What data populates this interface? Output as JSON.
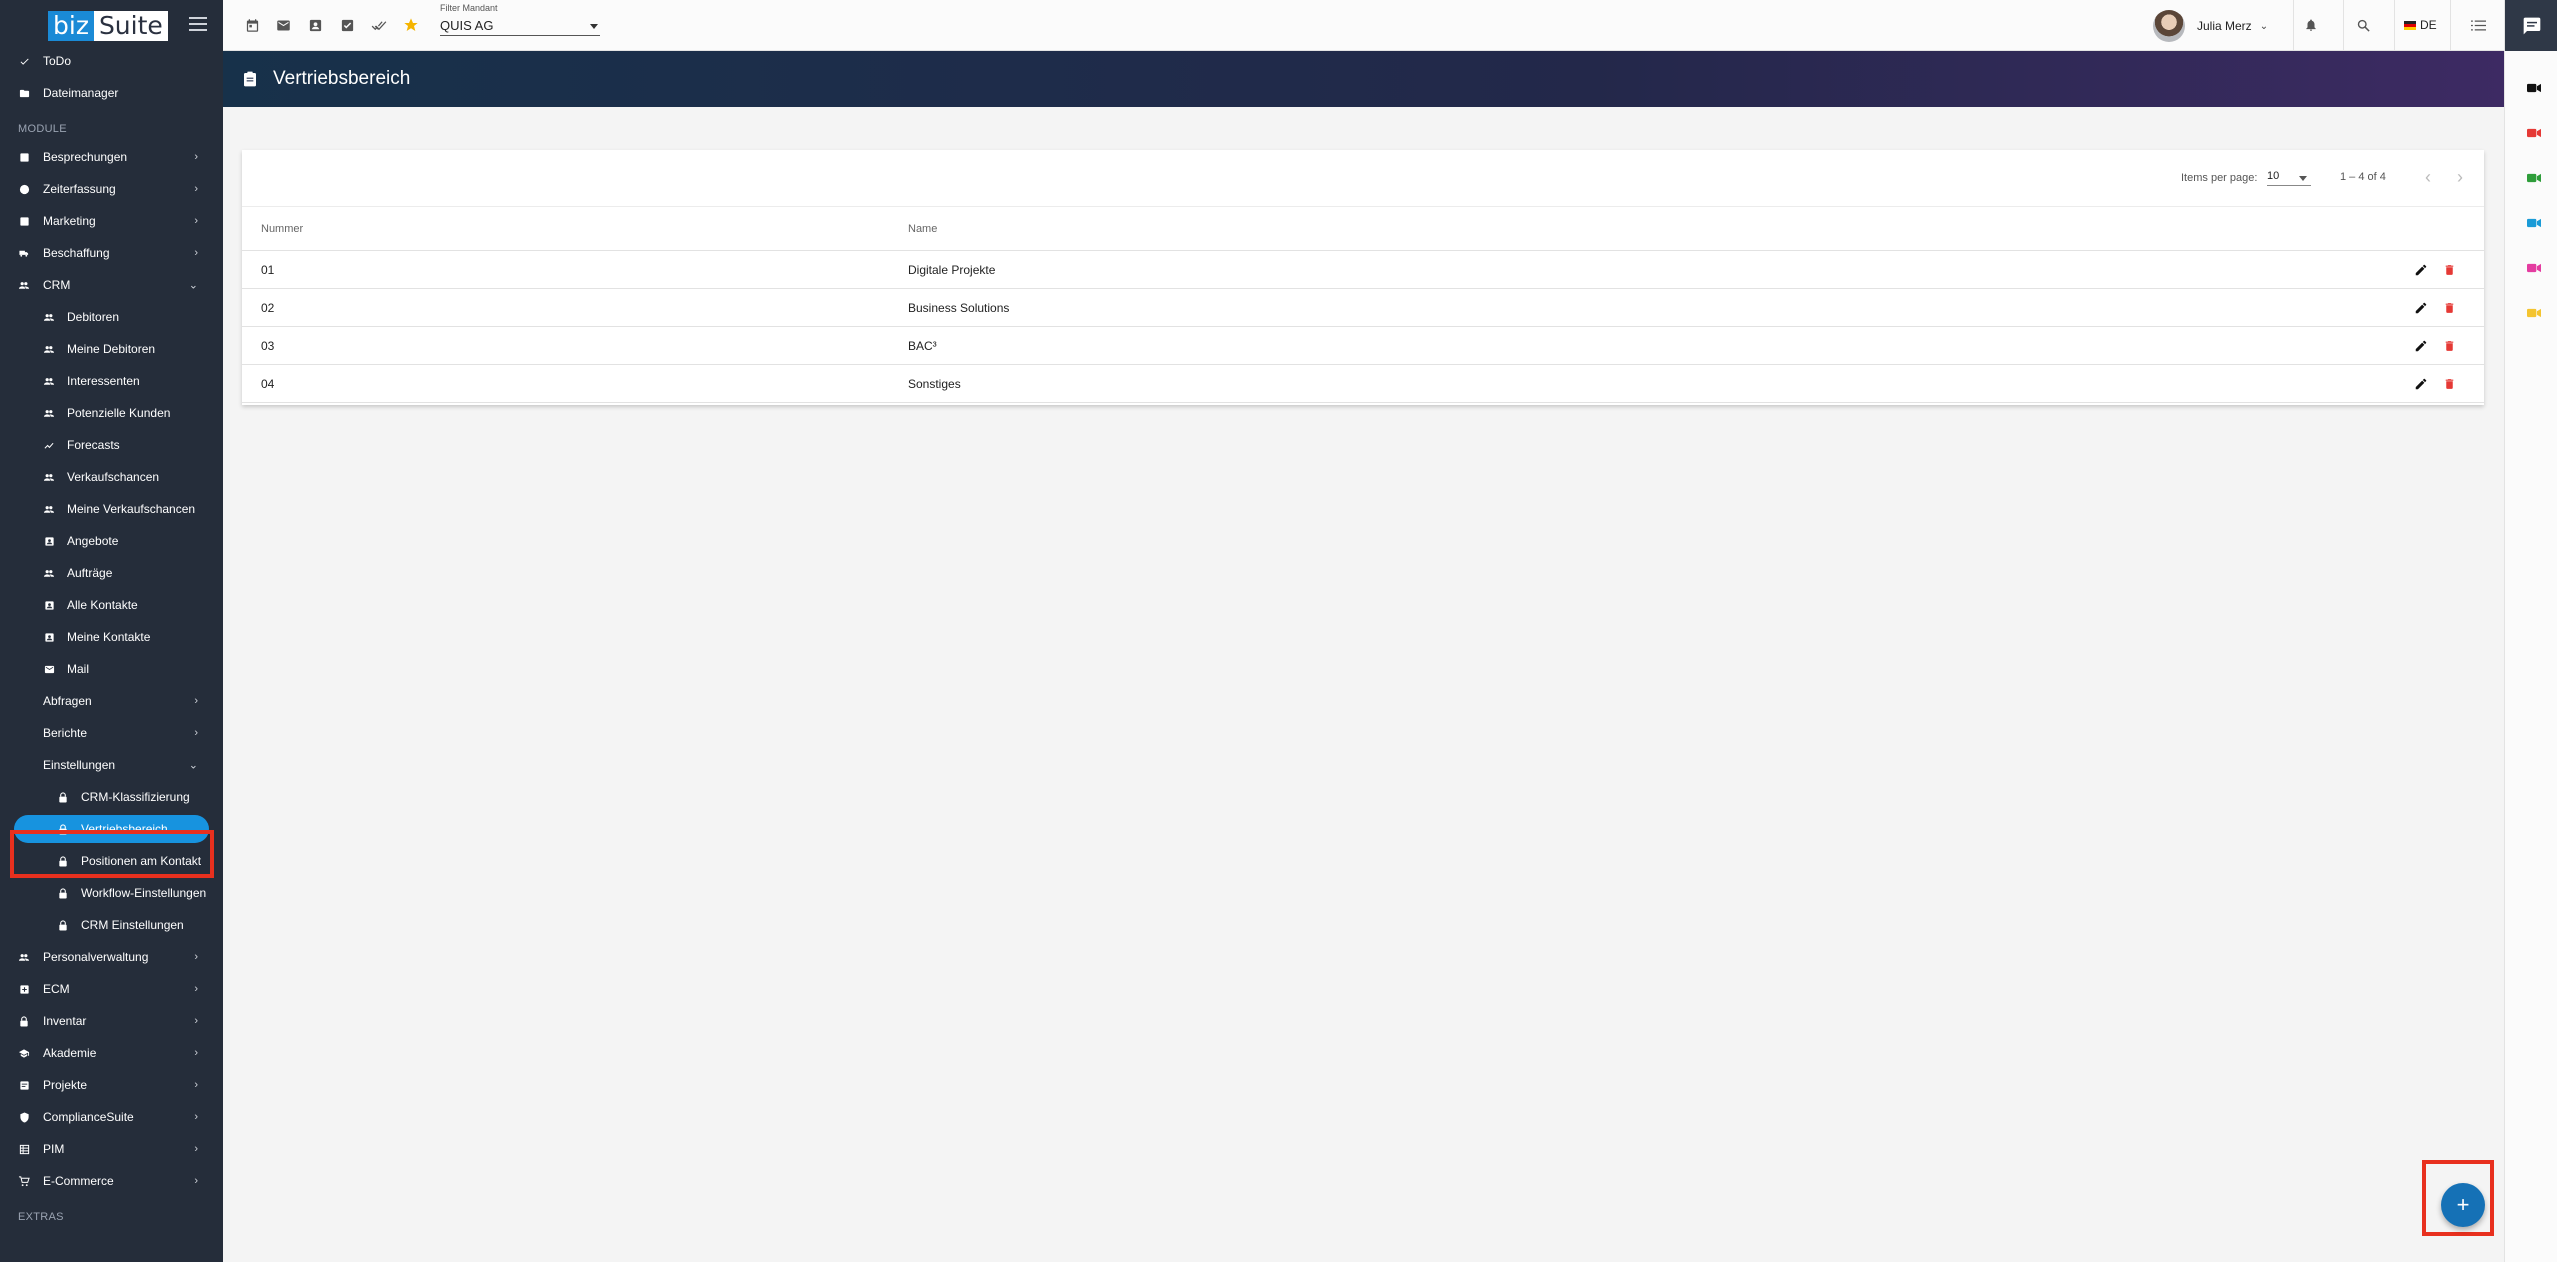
{
  "app": {
    "logo_left": "biz",
    "logo_right": "Suite"
  },
  "topbar": {
    "filter_label": "Filter Mandant",
    "filter_value": "QUIS AG",
    "user_name": "Julia Merz",
    "language": "DE"
  },
  "sidebar": {
    "top_items": [
      {
        "label": "ToDo",
        "icon": "check-icon"
      },
      {
        "label": "Dateimanager",
        "icon": "folder-icon"
      }
    ],
    "section_module": "MODULE",
    "modules": [
      {
        "label": "Besprechungen",
        "icon": "meeting-icon"
      },
      {
        "label": "Zeiterfassung",
        "icon": "clock-icon"
      },
      {
        "label": "Marketing",
        "icon": "marketing-icon"
      },
      {
        "label": "Beschaffung",
        "icon": "truck-icon"
      }
    ],
    "crm": {
      "label": "CRM",
      "items": [
        {
          "label": "Debitoren",
          "icon": "people-icon"
        },
        {
          "label": "Meine Debitoren",
          "icon": "people-icon"
        },
        {
          "label": "Interessenten",
          "icon": "people-icon"
        },
        {
          "label": "Potenzielle Kunden",
          "icon": "people-icon"
        },
        {
          "label": "Forecasts",
          "icon": "forecast-icon"
        },
        {
          "label": "Verkaufschancen",
          "icon": "people-icon"
        },
        {
          "label": "Meine Verkaufschancen",
          "icon": "people-icon"
        },
        {
          "label": "Angebote",
          "icon": "contact-card-icon"
        },
        {
          "label": "Aufträge",
          "icon": "people-icon"
        },
        {
          "label": "Alle Kontakte",
          "icon": "contact-card-icon"
        },
        {
          "label": "Meine Kontakte",
          "icon": "contact-card-icon"
        },
        {
          "label": "Mail",
          "icon": "mail-icon"
        }
      ],
      "sub_groups": [
        {
          "label": "Abfragen"
        },
        {
          "label": "Berichte"
        }
      ],
      "settings": {
        "label": "Einstellungen",
        "items": [
          {
            "label": "CRM-Klassifizierung"
          },
          {
            "label": "Vertriebsbereich"
          },
          {
            "label": "Positionen am Kontakt"
          },
          {
            "label": "Workflow-Einstellungen"
          },
          {
            "label": "CRM Einstellungen"
          }
        ]
      }
    },
    "modules_after": [
      {
        "label": "Personalverwaltung",
        "icon": "people-icon"
      },
      {
        "label": "ECM",
        "icon": "ecm-icon"
      },
      {
        "label": "Inventar",
        "icon": "lock-icon"
      },
      {
        "label": "Akademie",
        "icon": "school-icon"
      },
      {
        "label": "Projekte",
        "icon": "project-icon"
      },
      {
        "label": "ComplianceSuite",
        "icon": "shield-icon"
      },
      {
        "label": "PIM",
        "icon": "pim-icon"
      },
      {
        "label": "E-Commerce",
        "icon": "cart-icon"
      }
    ],
    "section_extras": "EXTRAS"
  },
  "page": {
    "title": "Vertriebsbereich"
  },
  "paginator": {
    "items_per_page_label": "Items per page:",
    "items_per_page_value": "10",
    "range": "1 – 4 of 4"
  },
  "table": {
    "columns": [
      "Nummer",
      "Name"
    ],
    "rows": [
      {
        "nummer": "01",
        "name": "Digitale Projekte"
      },
      {
        "nummer": "02",
        "name": "Business Solutions"
      },
      {
        "nummer": "03",
        "name": "BAC³"
      },
      {
        "nummer": "04",
        "name": "Sonstiges"
      }
    ]
  },
  "fab": {
    "label": "+"
  },
  "colors": {
    "sidebar_bg": "#252d3a",
    "active_pill": "#1793df",
    "highlight": "#e8301e",
    "delete": "#e53935",
    "fab": "#1571b6"
  }
}
